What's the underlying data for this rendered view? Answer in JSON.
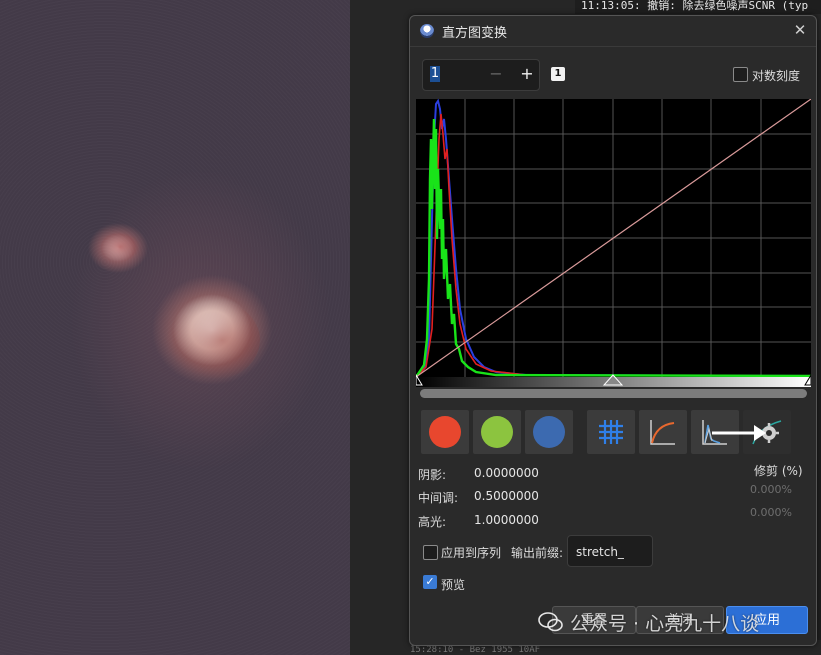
{
  "console": {
    "top_line": "11:13:05: 撤销: 除去绿色噪声SCNR (typ",
    "bottom_line": "15:28:10 - Bez  1955 10AF"
  },
  "dialog": {
    "title": "直方图变换",
    "close_glyph": "✕",
    "zoom": {
      "value": "1",
      "minus": "−",
      "plus": "+",
      "badge": "1"
    },
    "log_scale_label": "对数刻度",
    "log_scale_checked": false,
    "channels": [
      {
        "name": "red",
        "color": "#e8472e"
      },
      {
        "name": "green",
        "color": "#8cc43f"
      },
      {
        "name": "blue",
        "color": "#3c6ab0"
      }
    ],
    "tools": [
      "grid-icon",
      "curve-icon",
      "histogram-overlay-icon",
      "gear-icon"
    ],
    "values": {
      "shadows_label": "阴影:",
      "shadows": "0.0000000",
      "midtones_label": "中间调:",
      "midtones": "0.5000000",
      "highlights_label": "高光:",
      "highlights": "1.0000000"
    },
    "clipping": {
      "title": "修剪 (%)",
      "low": "0.000%",
      "high": "0.000%"
    },
    "apply_to_sequence_label": "应用到序列",
    "apply_to_sequence_checked": false,
    "output_prefix_label": "输出前缀:",
    "output_prefix_value": "stretch_",
    "preview_label": "预览",
    "preview_checked": true,
    "buttons": {
      "reset": "重置",
      "cancel": "关闭",
      "apply": "应用"
    }
  },
  "watermark": {
    "text": "公众号 · 心亮九十八谈"
  }
}
